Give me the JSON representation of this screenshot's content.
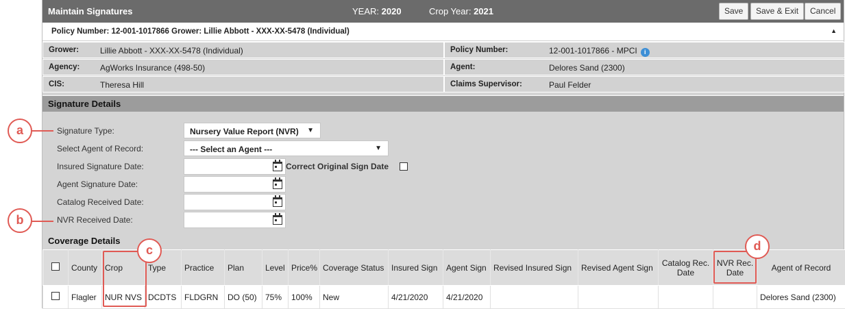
{
  "header": {
    "title": "Maintain Signatures",
    "year_label": "YEAR:",
    "year_value": "2020",
    "crop_year_label": "Crop Year:",
    "crop_year_value": "2021",
    "buttons": {
      "save": "Save",
      "save_exit": "Save & Exit",
      "cancel": "Cancel"
    }
  },
  "policy_bar": {
    "text": "Policy Number: 12-001-1017866 Grower: Lillie Abbott - XXX-XX-5478 (Individual)",
    "collapse_icon": "triangle-up-icon"
  },
  "info": {
    "grower_label": "Grower:",
    "grower_value": "Lillie Abbott - XXX-XX-5478 (Individual)",
    "policy_label": "Policy Number:",
    "policy_value": "12-001-1017866 - MPCI",
    "agency_label": "Agency:",
    "agency_value": "AgWorks Insurance (498-50)",
    "agent_label": "Agent:",
    "agent_value": "Delores Sand (2300)",
    "cis_label": "CIS:",
    "cis_value": "Theresa Hill",
    "claims_label": "Claims Supervisor:",
    "claims_value": "Paul Felder",
    "info_icon": "i"
  },
  "signature_details": {
    "heading": "Signature Details",
    "signature_type_label": "Signature Type:",
    "signature_type_value": "Nursery Value Report (NVR)",
    "agent_of_record_label": "Select Agent of Record:",
    "agent_of_record_value": "--- Select an Agent ---",
    "insured_sig_label": "Insured Signature Date:",
    "correct_original_label": "Correct Original Sign Date",
    "agent_sig_label": "Agent Signature Date:",
    "catalog_received_label": "Catalog Received Date:",
    "nvr_received_label": "NVR Received Date:"
  },
  "coverage": {
    "heading": "Coverage Details",
    "columns": [
      "County",
      "Crop",
      "Type",
      "Practice",
      "Plan",
      "Level",
      "Price%",
      "Coverage Status",
      "Insured Sign",
      "Agent Sign",
      "Revised Insured Sign",
      "Revised Agent Sign",
      "Catalog Rec. Date",
      "NVR Rec. Date",
      "Agent of Record"
    ],
    "rows": [
      {
        "county": "Flagler",
        "crop": "NUR NVS",
        "type": "DCDTS",
        "practice": "FLDGRN",
        "plan": "DO (50)",
        "level": "75%",
        "price": "100%",
        "status": "New",
        "insured_sign": "4/21/2020",
        "agent_sign": "4/21/2020",
        "rev_insured": "",
        "rev_agent": "",
        "catalog_rec": "",
        "nvr_rec": "",
        "agent_of_record": "Delores Sand (2300)"
      }
    ]
  },
  "annotations": {
    "a": "a",
    "b": "b",
    "c": "c",
    "d": "d"
  },
  "colors": {
    "accent_marker": "#e05a54",
    "title_bar": "#6b6b6b",
    "section_header": "#9c9c9c",
    "panel": "#d4d4d4"
  }
}
